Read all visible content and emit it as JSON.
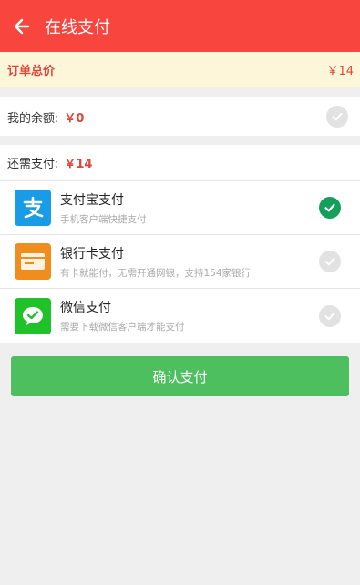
{
  "header": {
    "title": "在线支付"
  },
  "order_total": {
    "label": "订单总价",
    "amount": "￥14"
  },
  "balance": {
    "label": "我的余额:",
    "amount": "￥0"
  },
  "need_pay": {
    "label": "还需支付:",
    "amount": "￥14"
  },
  "payment_methods": [
    {
      "name": "支付宝支付",
      "desc": "手机客户端快捷支付",
      "icon": "alipay-icon",
      "color": "#1a9be6",
      "selected": true
    },
    {
      "name": "银行卡支付",
      "desc": "有卡就能付，无需开通网银，支持154家银行",
      "icon": "bank-card-icon",
      "color": "#ef8d1e",
      "selected": false
    },
    {
      "name": "微信支付",
      "desc": "需要下载微信客户端才能支付",
      "icon": "wechat-icon",
      "color": "#20c22a",
      "selected": false
    }
  ],
  "confirm_button": {
    "label": "确认支付"
  },
  "colors": {
    "primary": "#f8463f",
    "accent_red": "#e0453a",
    "confirm_green": "#4dbf5e",
    "check_green": "#14a05a"
  }
}
